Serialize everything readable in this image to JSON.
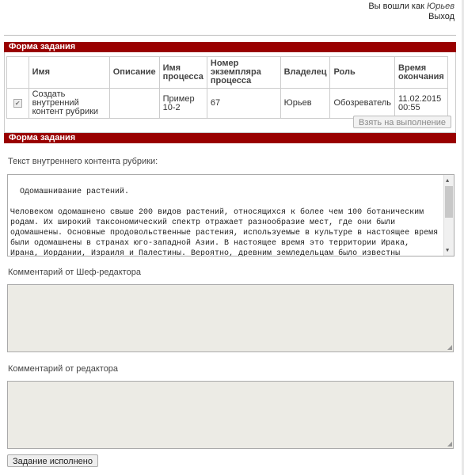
{
  "user": {
    "logged_in_prefix": "Вы вошли как",
    "username": "Юрьев",
    "logout": "Выход"
  },
  "section1": {
    "title": "Форма задания"
  },
  "table": {
    "headers": [
      "",
      "Имя",
      "Описание",
      "Имя процесса",
      "Номер экземпляра процесса",
      "Владелец",
      "Роль",
      "Время окончания"
    ],
    "rows": [
      {
        "checked": true,
        "name": "Создать внутренний контент рубрики",
        "description": "",
        "process_name": "Пример 10-2",
        "instance_number": "67",
        "owner": "Юрьев",
        "role": "Обозреватель",
        "end_time": "11.02.2015 00:55"
      }
    ]
  },
  "take_button": "Взять на выполнение",
  "section2": {
    "title": "Форма задания"
  },
  "content_label": "Текст внутреннего контента рубрики:",
  "content_text": "Одомашнивание растений.\n\nЧеловеком одомашнено свыше 200 видов растений, относящихся к более чем 100 ботаническим родам. Их широкий таксономический спектр отражает разнообразие мест, где они были одомашнены. Основные продовольственные растения, используемые в культуре в настоящее время были одомашнены в странах юго-западной Азии. В настоящее время это территории Ирака, Ирана, Иордании, Израиля и Палестины. Вероятно, древним земледельцам было известны преимущества вегетативного размножения (клонирования) и близкородственного скрещивания (инбридинга).",
  "chief_editor_label": "Комментарий от Шеф-редактора",
  "chief_editor_value": "",
  "editor_label": "Комментарий от редактора",
  "editor_value": "",
  "done_button": "Задание исполнено"
}
